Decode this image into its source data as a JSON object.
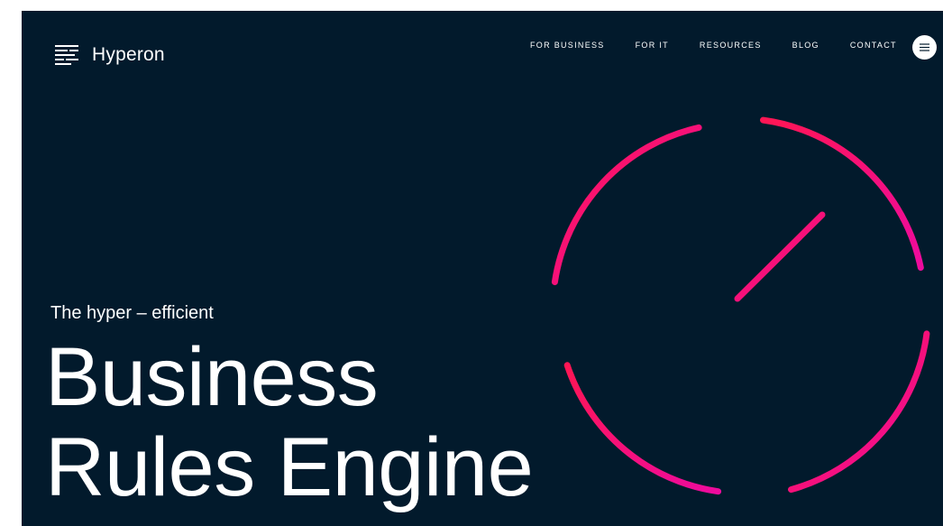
{
  "brand": {
    "name": "Hyperon",
    "icon": "document-lines-icon"
  },
  "nav": {
    "items": [
      {
        "label": "FOR BUSINESS"
      },
      {
        "label": "FOR IT"
      },
      {
        "label": "RESOURCES"
      },
      {
        "label": "BLOG"
      },
      {
        "label": "CONTACT"
      }
    ],
    "menu_icon": "hamburger-menu-icon"
  },
  "hero": {
    "tagline": "The hyper – efficient",
    "headline_line1": "Business",
    "headline_line2": "Rules Engine"
  },
  "colors": {
    "background": "#021a2c",
    "accent_start": "#ff1654",
    "accent_end": "#ee0b9e",
    "text": "#ffffff"
  }
}
